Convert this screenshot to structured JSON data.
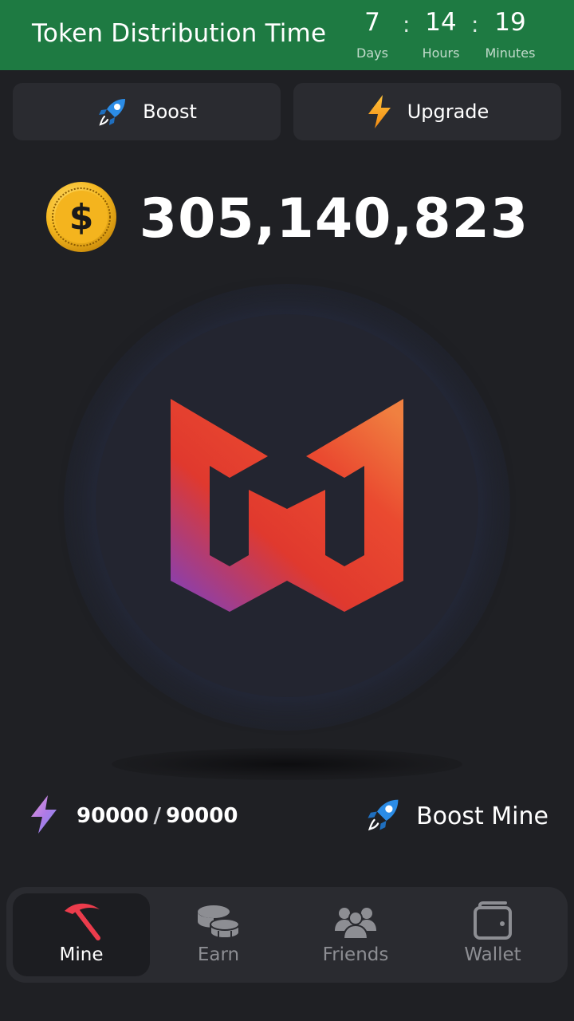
{
  "header": {
    "title": "Token Distribution Time",
    "countdown": {
      "days": "7",
      "days_label": "Days",
      "hours": "14",
      "hours_label": "Hours",
      "minutes": "19",
      "minutes_label": "Minutes",
      "separator": ":"
    },
    "background": "#1e7a42"
  },
  "top_buttons": {
    "boost_label": "Boost",
    "upgrade_label": "Upgrade",
    "boost_icon": "rocket-icon",
    "upgrade_icon": "lightning-icon"
  },
  "balance": {
    "value": "305,140,823",
    "icon": "dollar-coin-icon"
  },
  "mine_button": {
    "icon": "w-logo-icon"
  },
  "energy": {
    "current": "90000",
    "max": "90000",
    "separator": "/",
    "icon": "lightning-icon"
  },
  "boost_mine": {
    "label": "Boost Mine",
    "icon": "rocket-icon"
  },
  "nav": {
    "items": [
      {
        "label": "Mine",
        "icon": "pickaxe-icon",
        "active": true
      },
      {
        "label": "Earn",
        "icon": "coins-icon",
        "active": false
      },
      {
        "label": "Friends",
        "icon": "friends-icon",
        "active": false
      },
      {
        "label": "Wallet",
        "icon": "wallet-icon",
        "active": false
      }
    ]
  },
  "colors": {
    "background": "#1f2024",
    "card": "#2a2b30",
    "accent_green": "#1e7a42",
    "logo_gradient": [
      "#f07a3a",
      "#e8392c",
      "#9b3fa0"
    ]
  }
}
